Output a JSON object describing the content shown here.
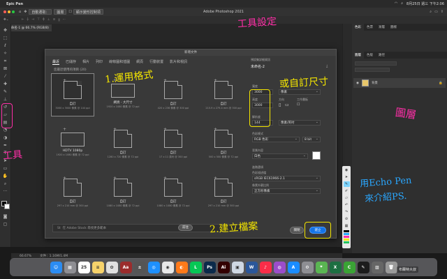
{
  "mac_menubar": {
    "app_name": "Epic Pen",
    "clock": "8月25日 週三 下午2:06"
  },
  "ps_appbar": {
    "window_title": "Adobe Photoshop 2021",
    "blend_mode": "正常",
    "auto_select_label": "自動選取：",
    "layer_select": "圖層"
  },
  "options_bar": {
    "transform_label": "顯示變形控制項"
  },
  "document": {
    "tab_label": "未命名-1 @ 66.7% (RGB/8)",
    "zoom": "66.67%",
    "doc_info": "文件：1.16M/1.4M"
  },
  "panels": {
    "tabs": [
      "色彩",
      "色票",
      "漸層",
      "圖樣"
    ],
    "layers_tabs": [
      "圖層",
      "色版",
      "路徑"
    ],
    "layer_name": "背景"
  },
  "dialog": {
    "title": "新增文件",
    "tabs": [
      "最近",
      "已儲存",
      "相片",
      "列印",
      "線條圖和插圖",
      "網頁",
      "行動裝置",
      "影片和視訊"
    ],
    "recent_heading": "您最近使用的項目 (20)",
    "presets": [
      {
        "name": "自訂",
        "dims": "3000 x 3000 像素 @ 144 ppi",
        "shape": "doc",
        "selected": true
      },
      {
        "name": "網頁 - 大尺寸",
        "dims": "1920 x 1080 像素 @ 72 ppi",
        "shape": "wide",
        "selected": false
      },
      {
        "name": "自訂",
        "dims": "420 x 236 像素 @ 300 ppi",
        "shape": "doc",
        "selected": false
      },
      {
        "name": "自訂",
        "dims": "215.9 x 279.4 mm @ 300 ppi",
        "shape": "doc",
        "selected": false
      },
      {
        "name": "HDTV 1080p",
        "dims": "1920 x 1080 像素 @ 72 ppi",
        "shape": "wide",
        "selected": false
      },
      {
        "name": "自訂",
        "dims": "1280 x 720 像素 @ 72 ppi",
        "shape": "doc",
        "selected": false
      },
      {
        "name": "自訂",
        "dims": "17 x 11 英吋 @ 300 ppi",
        "shape": "doc",
        "selected": false
      },
      {
        "name": "自訂",
        "dims": "500 x 500 像素 @ 72 ppi",
        "shape": "doc",
        "selected": false
      },
      {
        "name": "自訂",
        "dims": "297 x 210 mm @ 300 ppi",
        "shape": "doc",
        "selected": false
      },
      {
        "name": "自訂",
        "dims": "1080 x 1080 像素 @ 72 ppi",
        "shape": "doc",
        "selected": false
      },
      {
        "name": "自訂",
        "dims": "1080 x 1080 像素 @ 72 ppi",
        "shape": "doc",
        "selected": false
      },
      {
        "name": "自訂",
        "dims": "297 x 210 mm @ 300 ppi",
        "shape": "doc",
        "selected": false
      }
    ],
    "search_placeholder": "在 Adobe Stock 尋找更多範本",
    "search_go": "前往",
    "details": {
      "section_title": "預設集詳細資訊",
      "doc_name": "未命名-2",
      "width_label": "寬度",
      "width": "3000",
      "width_unit": "像素",
      "height_label": "高度",
      "height": "3000",
      "orientation_label": "方向",
      "artboard_label": "工作畫板",
      "resolution_label": "解析度",
      "resolution": "144",
      "resolution_unit": "像素/英吋",
      "color_mode_label": "色彩模式",
      "color_mode": "RGB 色彩",
      "bit_depth": "8 bit",
      "bg_label": "背景內容",
      "bg_value": "白色",
      "advanced_label": "進階選項",
      "color_profile_label": "色彩描述檔",
      "color_profile": "sRGB IEC61966-2.1",
      "pixel_aspect_label": "像素外觀比例",
      "pixel_aspect": "正方形像素"
    },
    "close_button": "關閉",
    "create_button": "建立"
  },
  "annotations": {
    "toolbar_settings": "工具設定",
    "apply_format": "1.運用格式",
    "custom_size": "或自訂尺寸",
    "create_file": "2.建立檔案",
    "layers": "圖層",
    "tools": "工具",
    "echo_pen_line1": "用Echo Pen",
    "echo_pen_line2": "來介紹PS."
  },
  "dock_apps": [
    {
      "name": "Finder",
      "label": "☺",
      "color": "#2b8cf2"
    },
    {
      "name": "Launchpad",
      "label": "▦",
      "color": "#8e8e93"
    },
    {
      "name": "Calendar",
      "label": "25",
      "color": "#ffffff"
    },
    {
      "name": "Notes",
      "label": "≡",
      "color": "#f7d36b"
    },
    {
      "name": "Photos",
      "label": "✿",
      "color": "#e0e0e0"
    },
    {
      "name": "Dictionary",
      "label": "Aa",
      "color": "#9b2c2c"
    },
    {
      "name": "Calculator",
      "label": "±",
      "color": "#555555"
    },
    {
      "name": "Safari",
      "label": "◎",
      "color": "#1e90ff"
    },
    {
      "name": "Chrome",
      "label": "◉",
      "color": "#e8e8e8"
    },
    {
      "name": "Firefox",
      "label": "◐",
      "color": "#ff7a1a"
    },
    {
      "name": "LINE",
      "label": "L",
      "color": "#06c755"
    },
    {
      "name": "Photoshop",
      "label": "Ps",
      "color": "#0b2a4a"
    },
    {
      "name": "Illustrator",
      "label": "Ai",
      "color": "#330000"
    },
    {
      "name": "Preview",
      "label": "▣",
      "color": "#cfd8e3"
    },
    {
      "name": "Word",
      "label": "W",
      "color": "#2b579a"
    },
    {
      "name": "Music",
      "label": "♪",
      "color": "#fa2d48"
    },
    {
      "name": "Podcasts",
      "label": "◍",
      "color": "#9b4dca"
    },
    {
      "name": "App Store",
      "label": "A",
      "color": "#1a8cff"
    },
    {
      "name": "System Preferences",
      "label": "⚙",
      "color": "#8e8e93"
    },
    {
      "name": "Maps",
      "label": "⌖",
      "color": "#5ab552"
    },
    {
      "name": "Excel",
      "label": "X",
      "color": "#1d6f42"
    },
    {
      "name": "Camtasia",
      "label": "C",
      "color": "#3aa335"
    },
    {
      "name": "Epic Pen",
      "label": "✎",
      "color": "#1c1c1c"
    },
    {
      "name": "Image Viewer",
      "label": "▨",
      "color": "#666666"
    },
    {
      "name": "Trash",
      "label": "🗑",
      "color": "#9a9a9a"
    }
  ],
  "watermark": "布蘭特大叔",
  "colors": {
    "annotation_pink": "#ff2fa8",
    "annotation_blue": "#2aa7ff",
    "highlight_yellow": "#f5e600",
    "create_blue": "#1473e6"
  }
}
